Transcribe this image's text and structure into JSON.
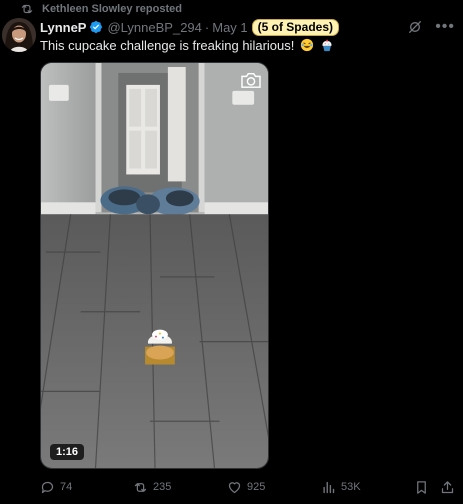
{
  "repost": {
    "text": "Kethleen Slowley reposted"
  },
  "author": {
    "name": "LynneP",
    "handle": "@LynneBP_294",
    "separator": "·",
    "date": "May 1"
  },
  "badge": {
    "label": "(5 of Spades)"
  },
  "tweet": {
    "text": "This cupcake challenge is freaking hilarious!",
    "emojis": [
      "rolling-on-floor-laughing",
      "cupcake"
    ]
  },
  "media": {
    "duration": "1:16"
  },
  "actions": {
    "replies": "74",
    "reposts": "235",
    "likes": "925",
    "views": "53K"
  },
  "colors": {
    "background": "#000000",
    "text": "#e7e9ea",
    "muted": "#71767b",
    "verified": "#1d9bf0",
    "badge_bg": "#fff2b3"
  }
}
